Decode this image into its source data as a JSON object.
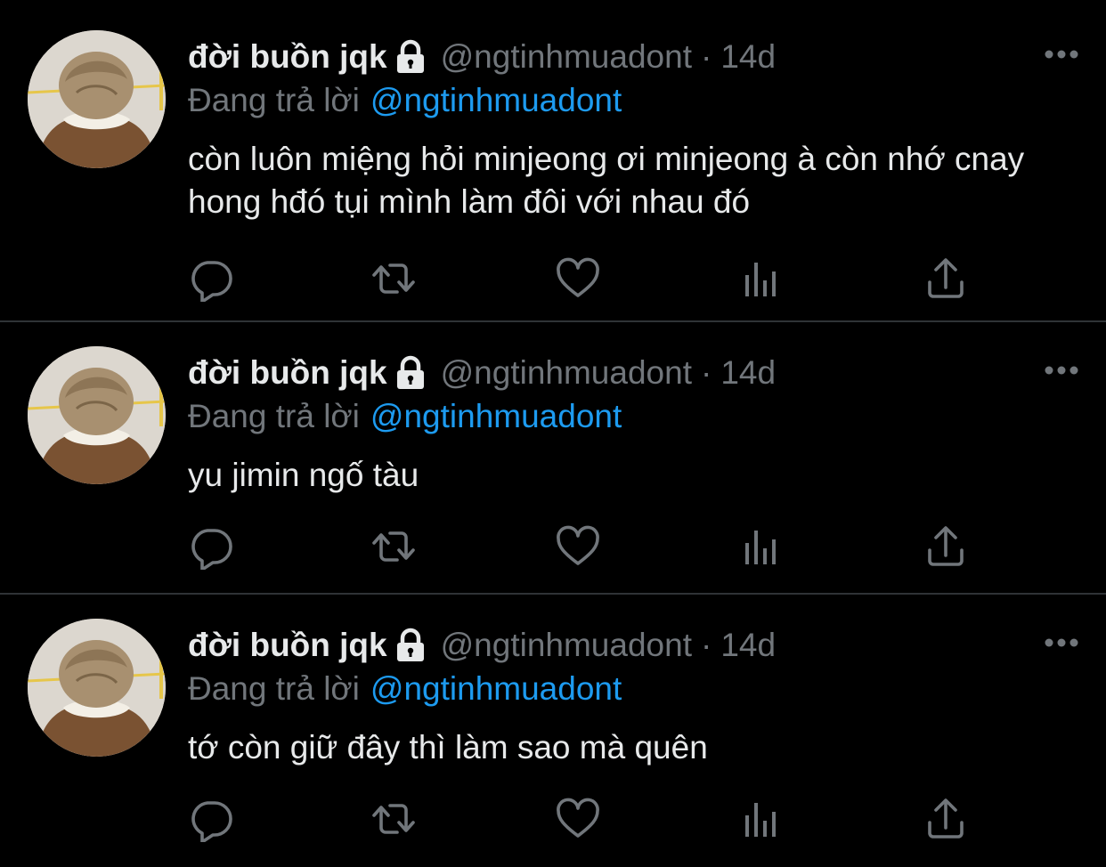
{
  "colors": {
    "background": "#000000",
    "text_primary": "#e7e9ea",
    "text_secondary": "#71767b",
    "link": "#1d9bf0",
    "divider": "#2f3336"
  },
  "tweets": [
    {
      "author_name": "đời buồn jqk",
      "handle": "@ngtinhmuadont",
      "separator": "·",
      "time": "14d",
      "reply_prefix": "Đang trả lời",
      "reply_to": "@ngtinhmuadont",
      "text": "còn luôn miệng hỏi minjeong ơi minjeong à còn nhớ cnay hong hđó tụi mình làm đôi với nhau đó",
      "icons": {
        "avatar": "profile-photo",
        "lock": "lock-icon",
        "more": "more-options-icon",
        "reply": "reply-bubble-icon",
        "retweet": "retweet-icon",
        "like": "heart-icon",
        "stats": "bar-chart-icon",
        "share": "share-upload-icon"
      }
    },
    {
      "author_name": "đời buồn jqk",
      "handle": "@ngtinhmuadont",
      "separator": "·",
      "time": "14d",
      "reply_prefix": "Đang trả lời",
      "reply_to": "@ngtinhmuadont",
      "text": "yu jimin ngố tàu",
      "icons": {
        "avatar": "profile-photo",
        "lock": "lock-icon",
        "more": "more-options-icon",
        "reply": "reply-bubble-icon",
        "retweet": "retweet-icon",
        "like": "heart-icon",
        "stats": "bar-chart-icon",
        "share": "share-upload-icon"
      }
    },
    {
      "author_name": "đời buồn jqk",
      "handle": "@ngtinhmuadont",
      "separator": "·",
      "time": "14d",
      "reply_prefix": "Đang trả lời",
      "reply_to": "@ngtinhmuadont",
      "text": "tớ còn giữ đây thì làm sao mà quên",
      "icons": {
        "avatar": "profile-photo",
        "lock": "lock-icon",
        "more": "more-options-icon",
        "reply": "reply-bubble-icon",
        "retweet": "retweet-icon",
        "like": "heart-icon",
        "stats": "bar-chart-icon",
        "share": "share-upload-icon"
      }
    }
  ]
}
